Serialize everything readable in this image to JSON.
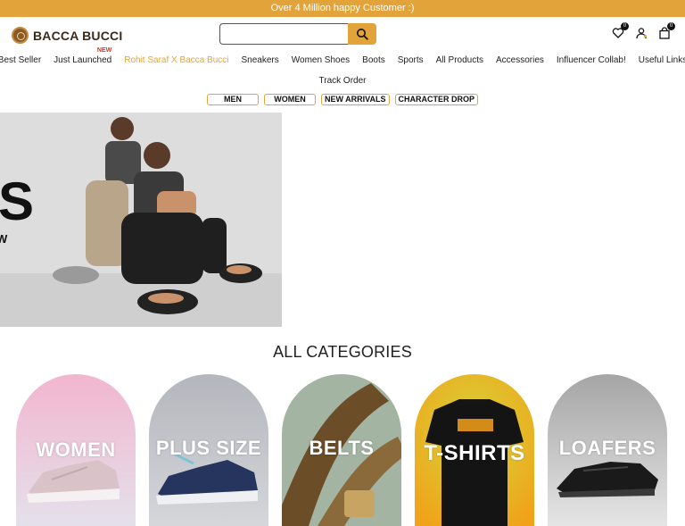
{
  "announcement": "Over 4 Million happy Customer :)",
  "brand": {
    "name": "BACCA BUCCI"
  },
  "search": {
    "placeholder": "",
    "button_icon": "search-icon"
  },
  "header_icons": {
    "wishlist_count": "0",
    "cart_count": "0"
  },
  "nav": {
    "items": [
      {
        "label": "Best Seller"
      },
      {
        "label": "Just Launched",
        "badge": "NEW"
      },
      {
        "label": "Rohit Saraf X Bacca Bucci"
      },
      {
        "label": "Sneakers"
      },
      {
        "label": "Women Shoes"
      },
      {
        "label": "Boots"
      },
      {
        "label": "Sports"
      },
      {
        "label": "All Products"
      },
      {
        "label": "Accessories"
      },
      {
        "label": "Influencer Collab!"
      },
      {
        "label": "Useful Links"
      }
    ],
    "row2": "Track Order"
  },
  "pills": [
    "MEN",
    "WOMEN",
    "NEW ARRIVALS",
    "CHARACTER DROP"
  ],
  "hero": {
    "text_big": "S",
    "text_small": "W"
  },
  "categories_title": "ALL CATEGORIES",
  "categories": [
    {
      "label": "WOMEN"
    },
    {
      "label": "PLUS SIZE"
    },
    {
      "label": "BELTS"
    },
    {
      "label": "T-SHIRTS"
    },
    {
      "label": "LOAFERS"
    }
  ],
  "colors": {
    "accent": "#e3a33b",
    "brand_brown": "#8a5a23",
    "new_badge": "#d32f2f"
  }
}
